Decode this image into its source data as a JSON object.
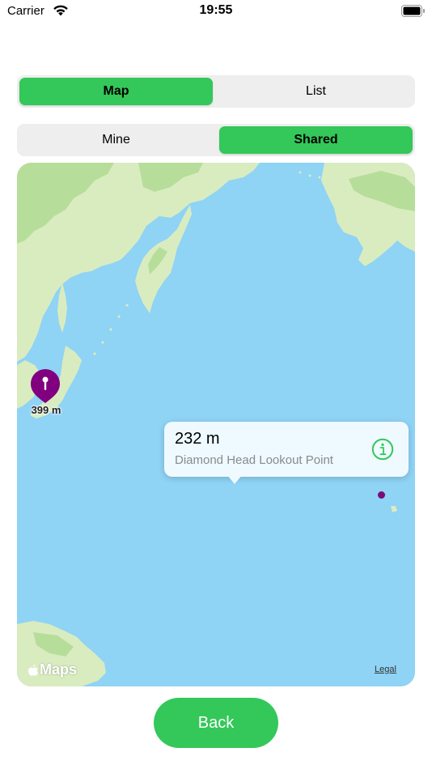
{
  "status_bar": {
    "carrier": "Carrier",
    "time": "19:55",
    "icons": [
      "wifi-icon",
      "battery-icon"
    ]
  },
  "view_toggle": {
    "options": [
      "Map",
      "List"
    ],
    "selected": "Map"
  },
  "owner_toggle": {
    "options": [
      "Mine",
      "Shared"
    ],
    "selected": "Shared"
  },
  "map": {
    "marker": {
      "label": "399 m",
      "color": "#800080"
    },
    "callout": {
      "title": "232 m",
      "subtitle": "Diamond Head Lookout Point",
      "icon": "info-icon",
      "icon_color": "#34c759"
    },
    "attribution": {
      "logo_text": "Maps",
      "legal_label": "Legal"
    },
    "colors": {
      "water": "#8fd3f5",
      "land": "#d9ecc0",
      "forest": "#b7dd9a"
    }
  },
  "back_button": {
    "label": "Back"
  },
  "colors": {
    "accent": "#34c759",
    "segment_background": "#eeeeef"
  }
}
